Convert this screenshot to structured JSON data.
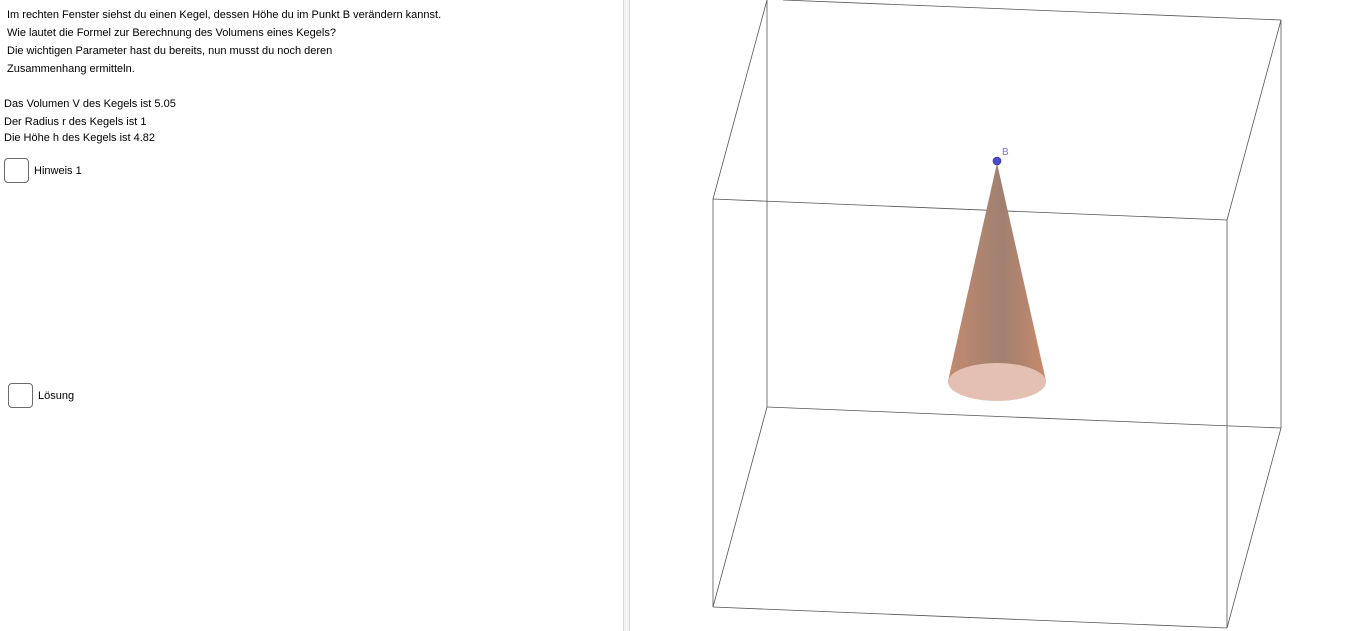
{
  "task": {
    "line1": "Im rechten Fenster siehst du einen Kegel, dessen Höhe du im Punkt B verändern kannst.",
    "line2": "Wie lautet die Formel zur Berechnung des Volumens eines Kegels?",
    "line3": "Die wichtigen Parameter hast du bereits, nun musst du  noch deren",
    "line4": "Zusammenhang ermitteln."
  },
  "values": {
    "volume": "Das Volumen V des Kegels ist 5.05",
    "radius": "Der Radius r des Kegels ist 1",
    "height": "Die Höhe h des Kegels ist 4.82"
  },
  "checkboxes": {
    "hint_label": "Hinweis 1",
    "hint_checked": false,
    "solution_label": "Lösung",
    "solution_checked": false
  },
  "graphics3d": {
    "point_label": "B",
    "colors": {
      "cone": "#c0876a",
      "base": "#e3c0b2",
      "point": "#4a4ad0",
      "label": "#7a7ad8",
      "box": "#555555"
    }
  }
}
